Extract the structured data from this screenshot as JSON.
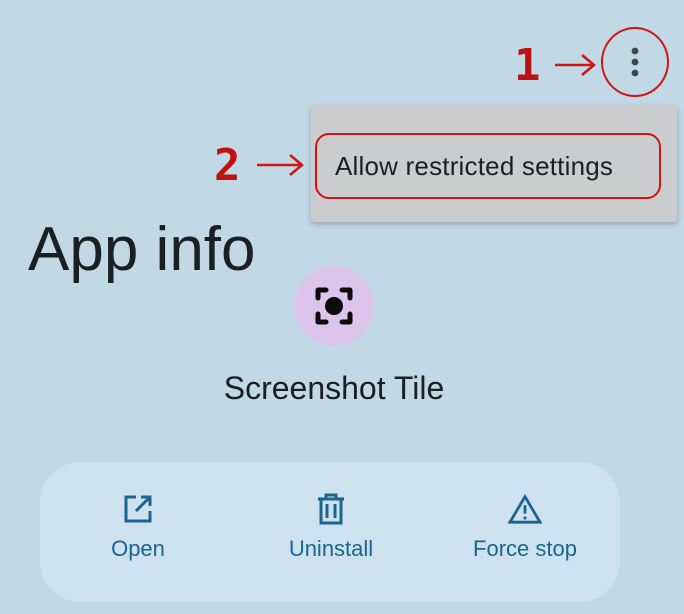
{
  "header": {
    "overflow_icon": "more-vert-icon"
  },
  "annotations": {
    "step1": "1",
    "step2": "2",
    "color": "#d11414"
  },
  "menu": {
    "items": [
      {
        "label": "Allow restricted settings"
      }
    ]
  },
  "page": {
    "title": "App info"
  },
  "app": {
    "name": "Screenshot Tile",
    "icon": "screenshot-icon",
    "icon_bg": "#ddc4ec"
  },
  "actions": [
    {
      "label": "Open",
      "icon": "open-external-icon"
    },
    {
      "label": "Uninstall",
      "icon": "trash-icon"
    },
    {
      "label": "Force stop",
      "icon": "warning-icon"
    }
  ],
  "colors": {
    "background": "#c1d8e5",
    "accent": "#1a6590",
    "card": "#cde2ee",
    "popup": "#cbcccd"
  }
}
